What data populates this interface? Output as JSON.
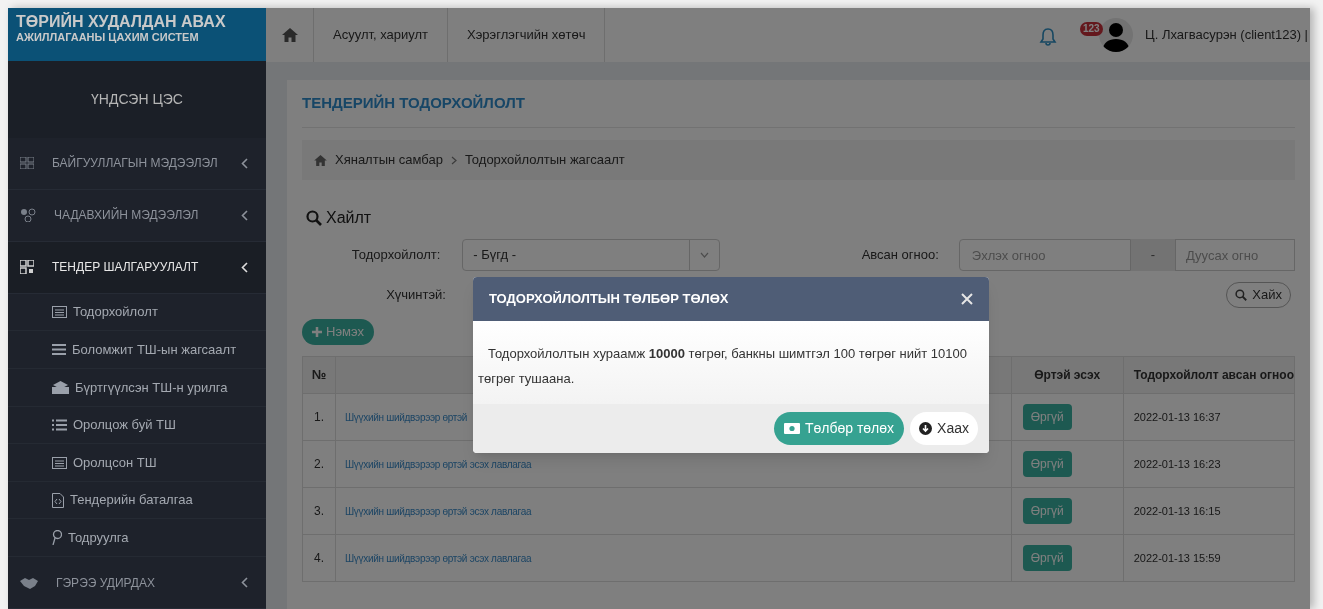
{
  "logo": {
    "line1": "ТӨРИЙН ХУДАЛДАН АВАХ",
    "line2": "АЖИЛЛАГААНЫ ЦАХИМ СИСТЕМ"
  },
  "sidebar": {
    "title": "ҮНДСЭН ЦЭС",
    "items": [
      {
        "label": "БАЙГУУЛЛАГЫН МЭДЭЭЛЭЛ",
        "expanded": false
      },
      {
        "label": "ЧАДАВХИЙН МЭДЭЭЛЭЛ",
        "expanded": false
      },
      {
        "label": "ТЕНДЕР ШАЛГАРУУЛАЛТ",
        "expanded": true,
        "children": [
          {
            "label": "Тодорхойлолт"
          },
          {
            "label": "Боломжит ТШ-ын жагсаалт"
          },
          {
            "label": "Бүртгүүлсэн ТШ-н урилга"
          },
          {
            "label": "Оролцож буй ТШ"
          },
          {
            "label": "Оролцсон ТШ"
          },
          {
            "label": "Тендерийн баталгаа"
          },
          {
            "label": "Тодруулга"
          }
        ]
      },
      {
        "label": "ГЭРЭЭ УДИРДАХ",
        "expanded": false
      }
    ]
  },
  "header": {
    "nav": [
      "Асуулт, хариулт",
      "Хэрэглэгчийн хөтөч"
    ],
    "notification_count": "123",
    "user": "Ц. Лхагвасурэн (client123) |"
  },
  "page": {
    "title": "ТЕНДЕРИЙН ТОДОРХОЙЛОЛТ",
    "breadcrumb": [
      "Хяналтын самбар",
      "Тодорхойлолтын жагсаалт"
    ],
    "search": {
      "title": "Хайлт",
      "type_label": "Тодорхойлолт:",
      "type_value": "- Бүгд -",
      "date_label": "Авсан огноо:",
      "date_from_placeholder": "Эхлэх огноо",
      "date_separator": "-",
      "date_to_placeholder": "Дуусах огно",
      "valid_label": "Хүчинтэй:",
      "search_button": "Хайх"
    },
    "add_button": "Нэмэх",
    "table": {
      "columns": {
        "number": "№",
        "debt": "Өртэй эсэх",
        "date": "Тодорхойлолт авсан огноо"
      },
      "rows": [
        {
          "number": "1.",
          "title": "Шүүхийн шийдвэрээр өртэй",
          "debt": "Өргүй",
          "date": "2022-01-13 16:37"
        },
        {
          "number": "2.",
          "title": "Шүүхийн шийдвэрээр өртэй эсэх лавлагаа",
          "debt": "Өргүй",
          "date": "2022-01-13 16:23"
        },
        {
          "number": "3.",
          "title": "Шүүхийн шийдвэрээр өртэй эсэх лавлагаа",
          "debt": "Өргүй",
          "date": "2022-01-13 16:15"
        },
        {
          "number": "4.",
          "title": "Шүүхийн шийдвэрээр өртэй эсэх лавлагаа",
          "debt": "Өргүй",
          "date": "2022-01-13 15:59"
        }
      ]
    }
  },
  "modal": {
    "title": "ТОДОРХОЙЛОЛТЫН ТӨЛБӨР ТӨЛӨХ",
    "message": "Тодорхойлолтын хураамж **10000** төгрөг, банкны шимтгэл 100 төгрөг нийт 10100 төгрөг тушаана.",
    "pay_button": "Төлбөр төлөх",
    "close_button": "Хаах"
  }
}
